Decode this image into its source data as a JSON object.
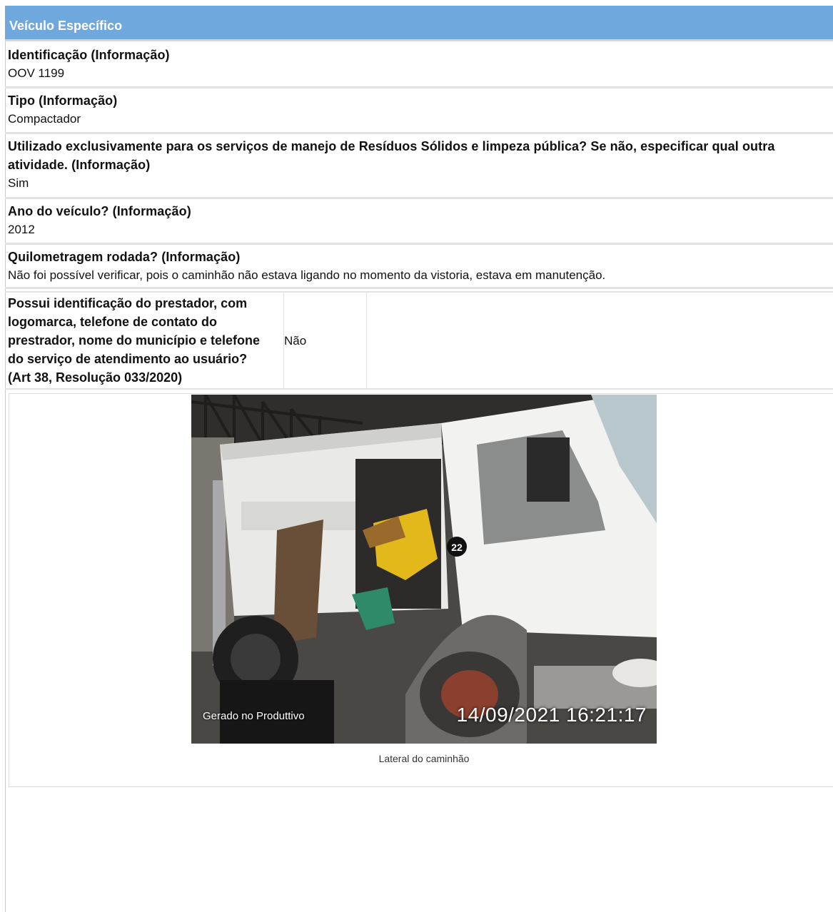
{
  "section": {
    "title": "Veículo Específico"
  },
  "fields": [
    {
      "label": "Identificação (Informação)",
      "value": "OOV 1199"
    },
    {
      "label": "Tipo (Informação)",
      "value": "Compactador"
    },
    {
      "label_line1": "Utilizado exclusivamente para os serviços de manejo de Resíduos Sólidos e limpeza pública? Se não, especificar qual outra",
      "label_line2": "atividade. (Informação)",
      "value": "Sim"
    },
    {
      "label": "Ano do veículo? (Informação)",
      "value": "2012"
    },
    {
      "label": "Quilometragem rodada? (Informação)",
      "value": "Não foi possível verificar, pois o caminhão não estava ligando no momento da vistoria, estava em manutenção."
    }
  ],
  "identification_question": {
    "lines": [
      "Possui identificação do prestador, com",
      "logomarca, telefone de contato do",
      "prestrador, nome do município e telefone",
      "do serviço de atendimento ao usuário?",
      "(Art 38, Resolução 033/2020)"
    ],
    "answer": "Não"
  },
  "photo": {
    "watermark": "Gerado no Produttivo",
    "timestamp": "14/09/2021 16:21:17",
    "truck_number": "22",
    "caption": "Lateral do caminhão"
  },
  "colors": {
    "header_bg": "#6fa8dc",
    "divider": "#e3e3e3"
  }
}
